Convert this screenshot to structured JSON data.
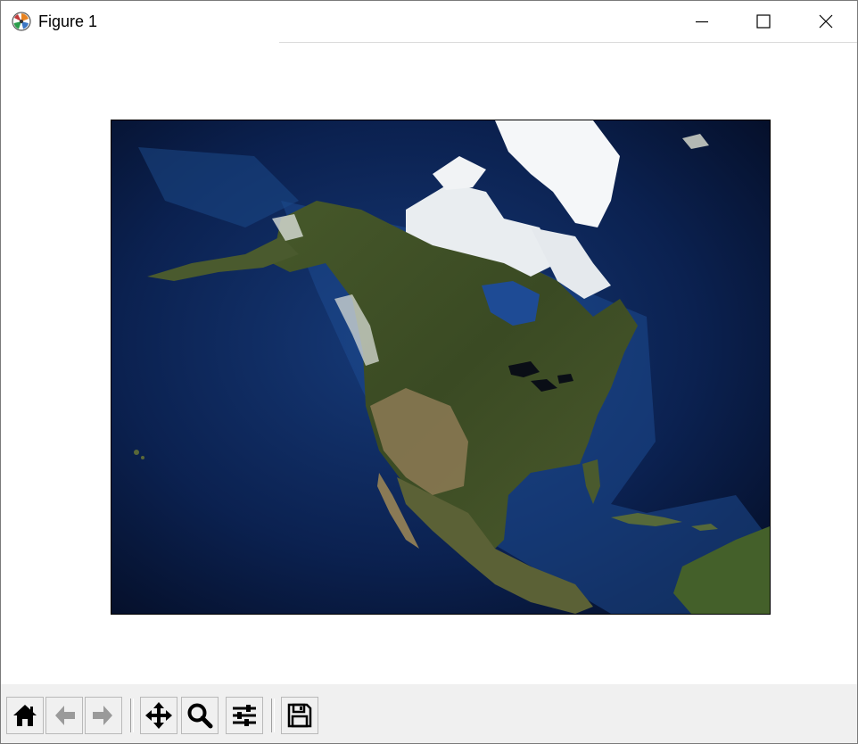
{
  "window": {
    "title": "Figure 1",
    "app_icon": "matplotlib-icon",
    "controls": [
      "minimize-icon",
      "maximize-icon",
      "close-icon"
    ]
  },
  "figure": {
    "content": "satellite-map-north-america",
    "frame_color": "#000000",
    "ocean_color": "#0a1b3d",
    "land_color": "#3e4f26",
    "ice_color": "#f3f5f7"
  },
  "toolbar": {
    "buttons": [
      {
        "name": "home-button",
        "icon": "home-icon"
      },
      {
        "name": "back-button",
        "icon": "back-arrow-icon"
      },
      {
        "name": "forward-button",
        "icon": "forward-arrow-icon"
      },
      {
        "name": "pan-button",
        "icon": "move-arrows-icon"
      },
      {
        "name": "zoom-button",
        "icon": "magnifier-icon"
      },
      {
        "name": "configure-subplots-button",
        "icon": "sliders-icon"
      },
      {
        "name": "save-button",
        "icon": "floppy-disk-icon"
      }
    ]
  }
}
